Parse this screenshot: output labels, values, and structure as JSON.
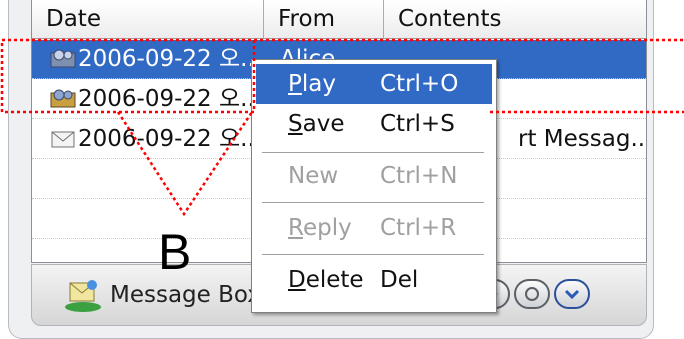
{
  "columns": [
    "Date",
    "From",
    "Contents"
  ],
  "rows": [
    {
      "icon": "video-message-icon",
      "date": "2006-09-22 오...",
      "from": "Alice",
      "contents": ""
    },
    {
      "icon": "video-message-icon",
      "date": "2006-09-22 오...",
      "from": "",
      "contents": ""
    },
    {
      "icon": "envelope-icon",
      "date": "2006-09-22 오...",
      "from": "",
      "contents": "rt Messag..."
    }
  ],
  "bottom_bar": {
    "message_box_label": "Message Box",
    "message_box_icon": "mailbox-icon",
    "nav_icons": [
      "prev-icon",
      "play-icon",
      "refresh-icon",
      "chevron-down-icon"
    ]
  },
  "context_menu": {
    "items": [
      {
        "label": "Play",
        "mnemonic": "P",
        "shortcut": "Ctrl+O",
        "state": "highlighted"
      },
      {
        "label": "Save",
        "mnemonic": "S",
        "shortcut": "Ctrl+S",
        "state": "enabled"
      },
      {
        "label": "New",
        "mnemonic": "",
        "shortcut": "Ctrl+N",
        "state": "disabled"
      },
      {
        "label": "Reply",
        "mnemonic": "R",
        "shortcut": "Ctrl+R",
        "state": "disabled"
      },
      {
        "label": "Delete",
        "mnemonic": "D",
        "shortcut": "Del",
        "state": "enabled"
      }
    ]
  },
  "annotation": {
    "label": "B",
    "color": "#ff0000"
  },
  "colors": {
    "selection": "#316ac5",
    "annotation_line": "#ff0000"
  }
}
